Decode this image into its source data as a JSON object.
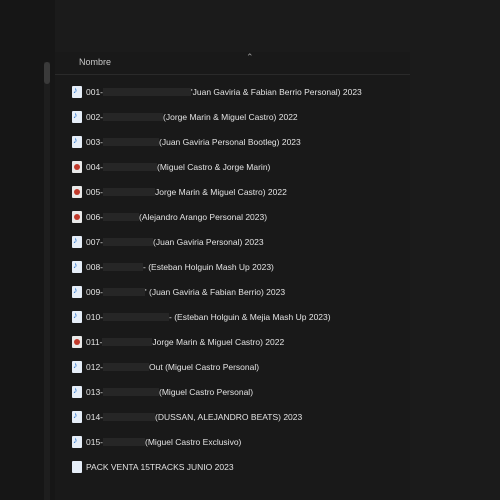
{
  "header": {
    "column_name": "Nombre",
    "sort_icon": "chevron-up-icon"
  },
  "files": [
    {
      "icon": "audio",
      "prefix": "001-",
      "suffix": "'Juan Gaviria & Fabian Berrio Personal) 2023"
    },
    {
      "icon": "audio",
      "prefix": "002-",
      "suffix": "(Jorge Marin & Miguel Castro) 2022"
    },
    {
      "icon": "audio",
      "prefix": "003-",
      "suffix": "(Juan Gaviria Personal Bootleg) 2023"
    },
    {
      "icon": "disc",
      "prefix": "004-",
      "suffix": "(Miguel Castro & Jorge Marin)"
    },
    {
      "icon": "disc",
      "prefix": "005-",
      "suffix": "Jorge Marin & Miguel Castro) 2022"
    },
    {
      "icon": "disc",
      "prefix": "006-",
      "suffix": "(Alejandro Arango Personal 2023)"
    },
    {
      "icon": "audio",
      "prefix": "007-",
      "suffix": "(Juan Gaviria Personal) 2023"
    },
    {
      "icon": "audio",
      "prefix": "008-",
      "suffix": "- (Esteban Holguin Mash Up 2023)"
    },
    {
      "icon": "audio",
      "prefix": "009-",
      "suffix": "' (Juan Gaviria & Fabian Berrio) 2023"
    },
    {
      "icon": "audio",
      "prefix": "010-",
      "suffix": "- (Esteban Holguin & Mejia Mash Up 2023)"
    },
    {
      "icon": "disc",
      "prefix": "011-",
      "suffix": "Jorge Marin & Miguel Castro) 2022"
    },
    {
      "icon": "audio",
      "prefix": "012-",
      "suffix": "Out (Miguel Castro Personal)"
    },
    {
      "icon": "audio",
      "prefix": "013-",
      "suffix": "(Miguel Castro Personal)"
    },
    {
      "icon": "audio",
      "prefix": "014-",
      "suffix": "(DUSSAN, ALEJANDRO BEATS) 2023"
    },
    {
      "icon": "audio",
      "prefix": "015-",
      "suffix": "(Miguel Castro Exclusivo)"
    },
    {
      "icon": "folder",
      "prefix": "",
      "suffix": "PACK VENTA 15TRACKS JUNIO 2023"
    }
  ]
}
